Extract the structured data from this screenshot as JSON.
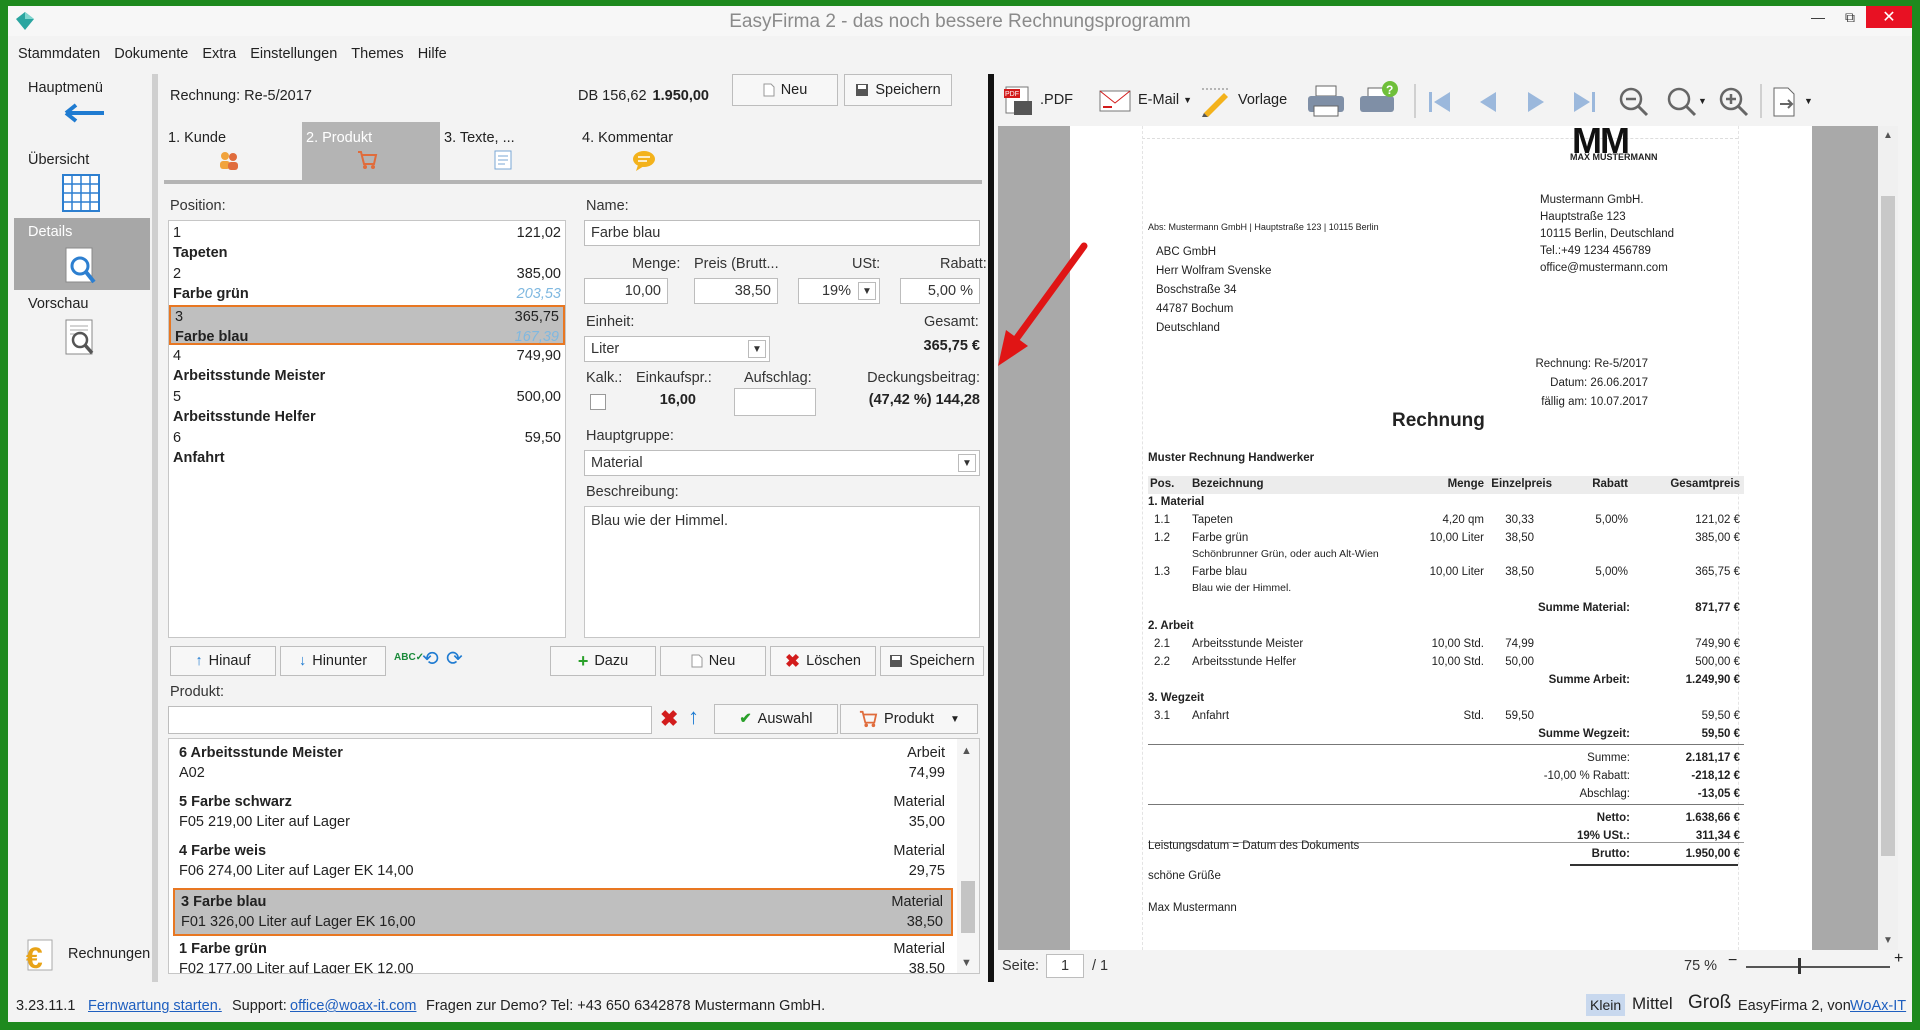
{
  "app": {
    "title": "EasyFirma 2 - das noch bessere Rechnungsprogramm"
  },
  "menu": [
    "Stammdaten",
    "Dokumente",
    "Extra",
    "Einstellungen",
    "Themes",
    "Hilfe"
  ],
  "nav": {
    "hauptmenu": "Hauptmenü",
    "ubersicht": "Übersicht",
    "details": "Details",
    "vorschau": "Vorschau",
    "rechnungen": "Rechnungen"
  },
  "header": {
    "rechnung": "Rechnung: Re-5/2017",
    "db_label": "DB 156,62",
    "db_value": "1.950,00",
    "neu": "Neu",
    "speichern": "Speichern"
  },
  "tabs": [
    "1. Kunde",
    "2. Produkt",
    "3. Texte, ...",
    "4. Kommentar"
  ],
  "positions": {
    "label": "Position:",
    "items": [
      {
        "num": "1",
        "value": "121,02",
        "name": "Tapeten",
        "sub": ""
      },
      {
        "num": "2",
        "value": "385,00",
        "name": "Farbe grün",
        "sub": "203,53"
      },
      {
        "num": "3",
        "value": "365,75",
        "name": "Farbe blau",
        "sub": "167,39"
      },
      {
        "num": "4",
        "value": "749,90",
        "name": "Arbeitsstunde Meister",
        "sub": ""
      },
      {
        "num": "5",
        "value": "500,00",
        "name": "Arbeitsstunde Helfer",
        "sub": ""
      },
      {
        "num": "6",
        "value": "59,50",
        "name": "Anfahrt",
        "sub": ""
      }
    ]
  },
  "form": {
    "name_label": "Name:",
    "name_value": "Farbe blau",
    "menge_label": "Menge:",
    "menge_value": "10,00",
    "preis_label": "Preis (Brutt...",
    "preis_value": "38,50",
    "ust_label": "USt:",
    "ust_value": "19%",
    "rabatt_label": "Rabatt:",
    "rabatt_value": "5,00 %",
    "einheit_label": "Einheit:",
    "einheit_value": "Liter",
    "gesamt_label": "Gesamt:",
    "gesamt_value": "365,75 €",
    "kalk_label": "Kalk.:",
    "einkauf_label": "Einkaufspr.:",
    "einkauf_value": "16,00",
    "aufschlag_label": "Aufschlag:",
    "deckung_label": "Deckungsbeitrag:",
    "deckung_value": "(47,42 %) 144,28",
    "hauptgruppe_label": "Hauptgruppe:",
    "hauptgruppe_value": "Material",
    "beschreibung_label": "Beschreibung:",
    "beschreibung_value": "Blau wie der Himmel."
  },
  "actions": {
    "hinauf": "Hinauf",
    "hinunter": "Hinunter",
    "dazu": "Dazu",
    "neu": "Neu",
    "loeschen": "Löschen",
    "speichern": "Speichern"
  },
  "produkt": {
    "label": "Produkt:",
    "auswahl": "Auswahl",
    "produkt_btn": "Produkt",
    "items": [
      {
        "title": "6 Arbeitsstunde Meister",
        "sub": "A02",
        "group": "Arbeit",
        "price": "74,99"
      },
      {
        "title": "5 Farbe schwarz",
        "sub": "F05 219,00 Liter auf Lager",
        "group": "Material",
        "price": "35,00"
      },
      {
        "title": "4 Farbe weis",
        "sub": "F06 274,00 Liter auf Lager EK 14,00",
        "group": "Material",
        "price": "29,75"
      },
      {
        "title": "3 Farbe blau",
        "sub": "F01 326,00 Liter auf Lager EK 16,00",
        "group": "Material",
        "price": "38,50"
      },
      {
        "title": "1 Farbe grün",
        "sub": "F02 177,00 Liter auf Lager EK 12,00",
        "group": "Material",
        "price": "38,50"
      }
    ]
  },
  "toolbar": {
    "pdf": ".PDF",
    "email": "E-Mail",
    "vorlage": "Vorlage"
  },
  "doc": {
    "logo_text": "MAX MUSTERMANN",
    "sender_line": "Abs: Mustermann GmbH | Hauptstraße 123 | 10115 Berlin",
    "company": [
      "Mustermann GmbH.",
      "Hauptstraße 123",
      "10115 Berlin, Deutschland",
      "Tel.:+49 1234 456789",
      "office@mustermann.com"
    ],
    "recipient": [
      "ABC GmbH",
      "Herr Wolfram Svenske",
      "Boschstraße 34",
      "44787 Bochum",
      "Deutschland"
    ],
    "meta": [
      "Rechnung: Re-5/2017",
      "Datum: 26.06.2017",
      "fällig am: 10.07.2017"
    ],
    "heading": "Rechnung",
    "subject": "Muster Rechnung Handwerker",
    "cols": [
      "Pos.",
      "Bezeichnung",
      "Menge",
      "Einzelpreis",
      "Rabatt",
      "Gesamtpreis"
    ],
    "group1": "1. Material",
    "rows1": [
      {
        "pos": "1.1",
        "name": "Tapeten",
        "menge": "4,20 qm",
        "ep": "30,33",
        "rabatt": "5,00%",
        "gp": "121,02 €",
        "desc": ""
      },
      {
        "pos": "1.2",
        "name": "Farbe grün",
        "menge": "10,00 Liter",
        "ep": "38,50",
        "rabatt": "",
        "gp": "385,00 €",
        "desc": "Schönbrunner Grün, oder auch Alt-Wien"
      },
      {
        "pos": "1.3",
        "name": "Farbe blau",
        "menge": "10,00 Liter",
        "ep": "38,50",
        "rabatt": "5,00%",
        "gp": "365,75 €",
        "desc": "Blau wie der Himmel."
      }
    ],
    "sum1_label": "Summe Material:",
    "sum1": "871,77 €",
    "group2": "2. Arbeit",
    "rows2": [
      {
        "pos": "2.1",
        "name": "Arbeitsstunde Meister",
        "menge": "10,00 Std.",
        "ep": "74,99",
        "gp": "749,90 €"
      },
      {
        "pos": "2.2",
        "name": "Arbeitsstunde Helfer",
        "menge": "10,00 Std.",
        "ep": "50,00",
        "gp": "500,00 €"
      }
    ],
    "sum2_label": "Summe Arbeit:",
    "sum2": "1.249,90 €",
    "group3": "3. Wegzeit",
    "rows3": [
      {
        "pos": "3.1",
        "name": "Anfahrt",
        "menge": "Std.",
        "ep": "59,50",
        "gp": "59,50 €"
      }
    ],
    "sum3_label": "Summe Wegzeit:",
    "sum3": "59,50 €",
    "totals": [
      {
        "label": "Summe:",
        "value": "2.181,17 €"
      },
      {
        "label": "-10,00 % Rabatt:",
        "value": "-218,12 €"
      },
      {
        "label": "Abschlag:",
        "value": "-13,05 €"
      }
    ],
    "netto_label": "Netto:",
    "netto": "1.638,66 €",
    "ust_label": "19%  USt.:",
    "ust": "311,34 €",
    "brutto_label": "Brutto:",
    "brutto": "1.950,00 €",
    "leistung": "Leistungsdatum = Datum des Dokuments",
    "gruesse": "schöne Grüße",
    "sign": "Max Mustermann"
  },
  "pager": {
    "label": "Seite:",
    "page": "1",
    "of": "/ 1",
    "zoom": "75 %"
  },
  "status": {
    "version": "3.23.11.1",
    "fernwartung": "Fernwartung starten.",
    "support": "Support:",
    "email": "office@woax-it.com",
    "demo": "Fragen zur Demo? Tel: +43 650 6342878 Mustermann GmbH.",
    "klein": "Klein",
    "mittel": "Mittel",
    "gross": "Groß",
    "credit": "EasyFirma 2, von",
    "credit_link": "WoAx-IT"
  }
}
